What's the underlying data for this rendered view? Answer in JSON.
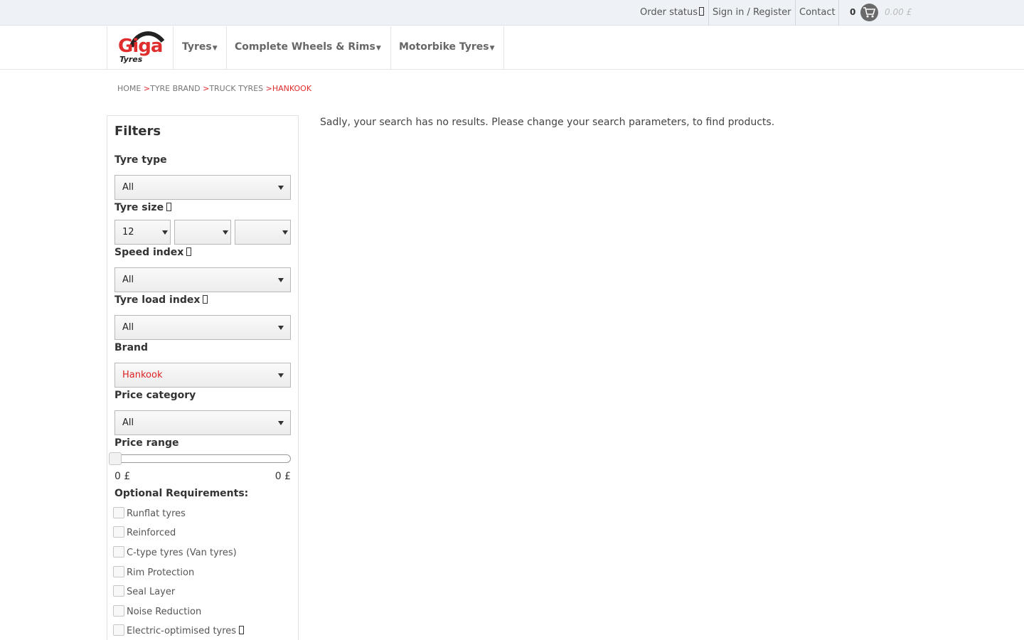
{
  "topbar": {
    "order_status": "Order status",
    "sign_in": "Sign in / Register",
    "contact": "Contact",
    "cart_count": "0",
    "cart_total": "0.00 £"
  },
  "header": {
    "logo_text": "Giga",
    "logo_sub": "Tyres",
    "nav": [
      "Tyres",
      "Complete Wheels & Rims",
      "Motorbike Tyres"
    ]
  },
  "breadcrumb": {
    "home": "HOME",
    "sep": ">",
    "tyre_brand": "TYRE BRAND",
    "truck_tyres": "TRUCK TYRES",
    "current": "HANKOOK"
  },
  "filters": {
    "title": "Filters",
    "tyre_type": {
      "label": "Tyre type",
      "value": "All"
    },
    "tyre_size": {
      "label": "Tyre size",
      "width": "12",
      "height": "",
      "rim": ""
    },
    "speed_index": {
      "label": "Speed index",
      "value": "All"
    },
    "load_index": {
      "label": "Tyre load index",
      "value": "All"
    },
    "brand": {
      "label": "Brand",
      "value": "Hankook"
    },
    "price_category": {
      "label": "Price category",
      "value": "All"
    },
    "price_range": {
      "label": "Price range",
      "min": "0 £",
      "max": "0 £"
    },
    "optional": {
      "label": "Optional Requirements:",
      "items": [
        "Runflat tyres",
        "Reinforced",
        "C-type tyres (Van tyres)",
        "Rim Protection",
        "Seal Layer",
        "Noise Reduction",
        "Electric-optimised tyres"
      ]
    }
  },
  "main": {
    "message": "Sadly, your search has no results. Please change your search parameters, to find products."
  },
  "colors": {
    "accent": "#e02d2d",
    "topbar_bg": "#eef2f6"
  }
}
